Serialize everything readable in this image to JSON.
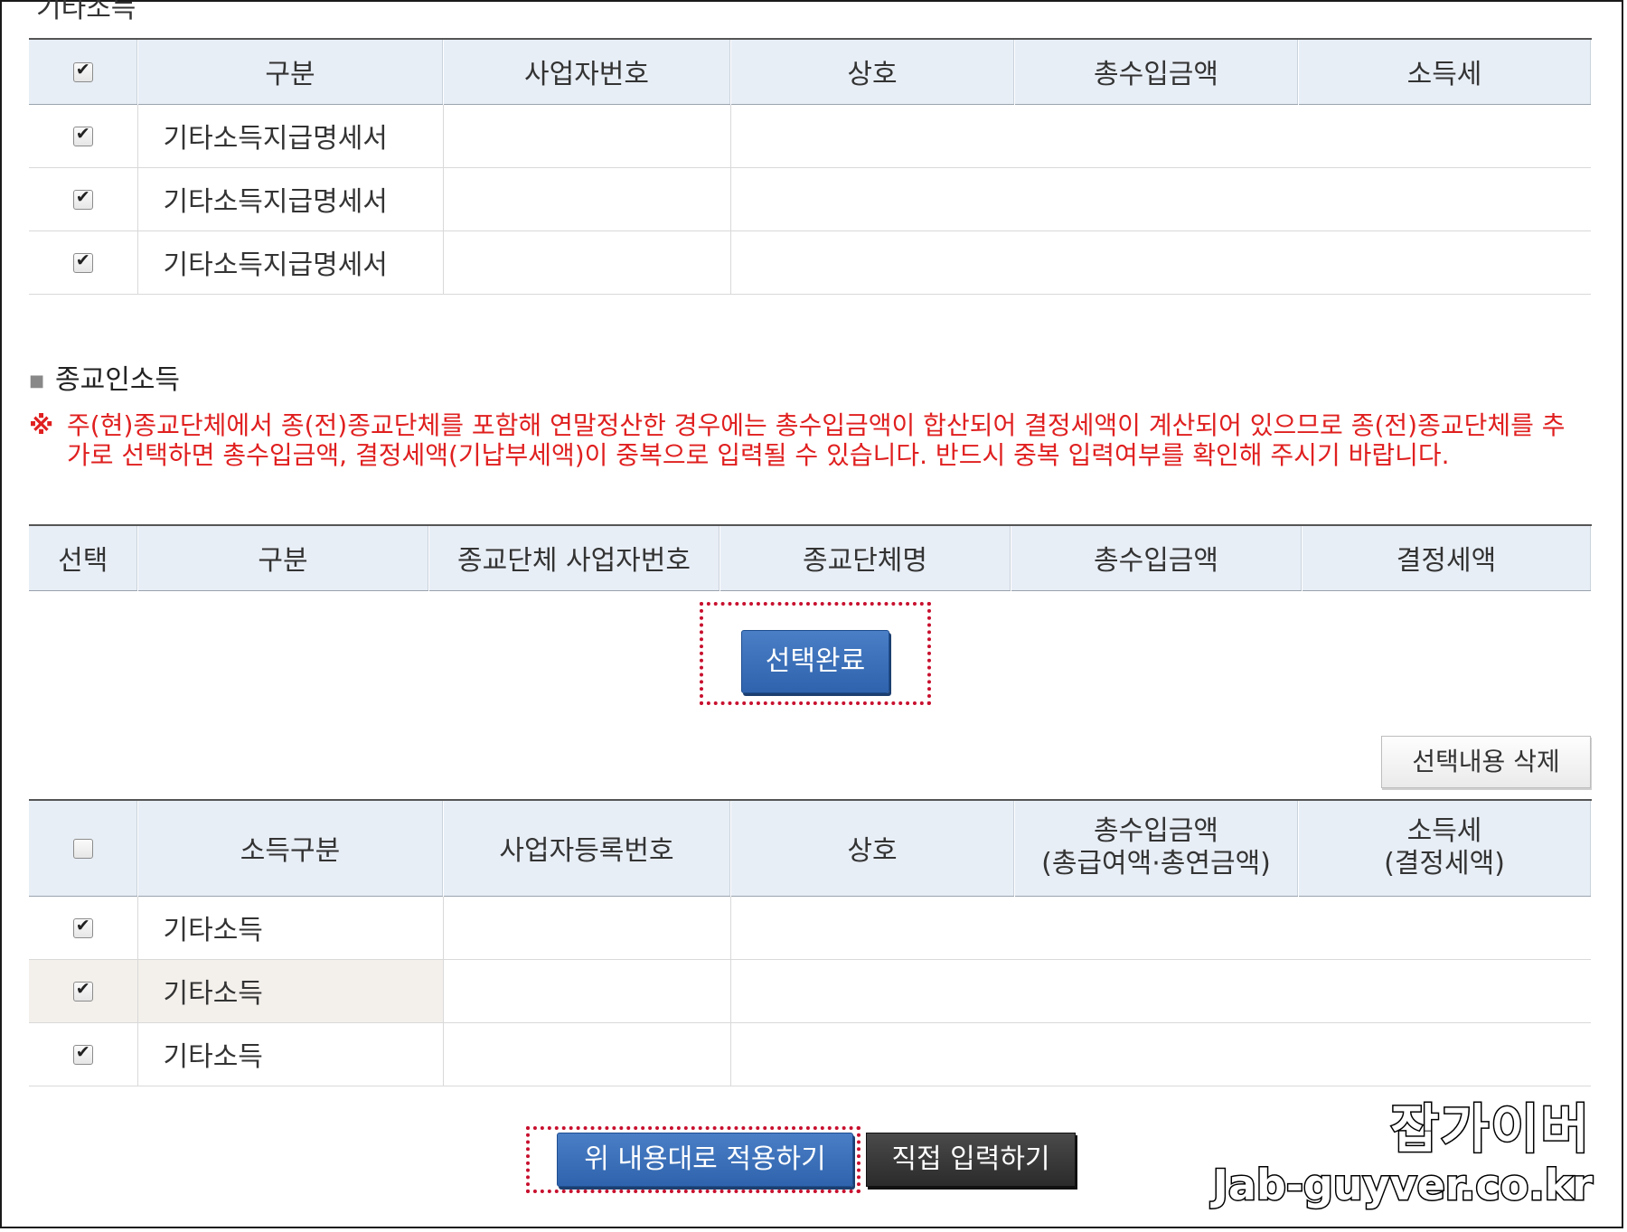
{
  "top_section": {
    "cut_title": "기타소득",
    "headers": [
      "구분",
      "사업자번호",
      "상호",
      "총수입금액",
      "소득세"
    ],
    "rows": [
      {
        "checked": true,
        "type": "기타소득지급명세서"
      },
      {
        "checked": true,
        "type": "기타소득지급명세서"
      },
      {
        "checked": true,
        "type": "기타소득지급명세서"
      }
    ]
  },
  "religion_section": {
    "title": "종교인소득",
    "notice_mark": "※",
    "notice": "주(현)종교단체에서 종(전)종교단체를 포함해 연말정산한 경우에는 총수입금액이 합산되어 결정세액이 계산되어 있으므로 종(전)종교단체를 추가로 선택하면 총수입금액, 결정세액(기납부세액)이 중복으로 입력될 수 있습니다. 반드시 중복 입력여부를 확인해 주시기 바랍니다.",
    "headers": [
      "선택",
      "구분",
      "종교단체 사업자번호",
      "종교단체명",
      "총수입금액",
      "결정세액"
    ],
    "select_done_label": "선택완료"
  },
  "result_section": {
    "delete_label": "선택내용 삭제",
    "header_checkbox_checked": false,
    "headers": {
      "income_type": "소득구분",
      "biz_reg_no": "사업자등록번호",
      "company": "상호",
      "total_income_1": "총수입금액",
      "total_income_2": "(총급여액·총연금액)",
      "tax_1": "소득세",
      "tax_2": "(결정세액)"
    },
    "rows": [
      {
        "checked": true,
        "type": "기타소득"
      },
      {
        "checked": true,
        "type": "기타소득"
      },
      {
        "checked": true,
        "type": "기타소득"
      }
    ]
  },
  "actions": {
    "apply_label": "위 내용대로 적용하기",
    "manual_label": "직접 입력하기"
  },
  "watermark": {
    "title": "잡가이버",
    "url": "Jab-guyver.co.kr"
  },
  "colors": {
    "header_bg": "#e8eef6",
    "notice_red": "#e01f1f",
    "button_blue": "#2f63ad",
    "highlight_dotted": "#c8102e"
  }
}
